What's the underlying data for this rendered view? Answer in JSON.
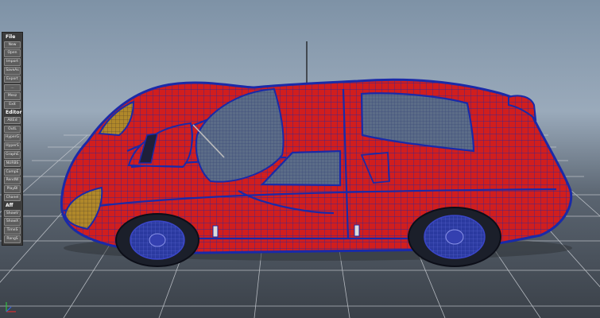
{
  "menu": {
    "sections": [
      {
        "title": "File",
        "items": [
          "New",
          "Open",
          "Import",
          "SaveAs",
          "Export",
          "...",
          "Mesz",
          "Exit"
        ]
      },
      {
        "title": "Editor",
        "items": [
          "AttEd",
          "OutL",
          "HyperG",
          "HyperS",
          "GraphE",
          "NURBS",
          "CompE",
          "RendW",
          "PlayBl",
          "Chanel"
        ]
      },
      {
        "title": "Aff",
        "items": [
          "ShowV",
          "ShowX",
          "TimeS",
          "RangS"
        ]
      }
    ]
  },
  "colors": {
    "body": "#d11e1e",
    "wireframe": "#1a2aa8",
    "glass": "#5b6c88",
    "headlight": "#b0882a",
    "grid": "#c8ccd2"
  },
  "icons": {
    "axis": "axis-indicator-icon"
  }
}
